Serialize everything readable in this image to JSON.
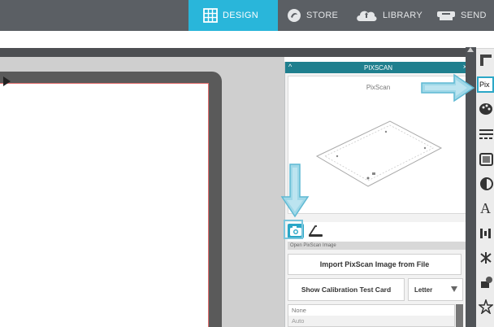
{
  "nav": {
    "tabs": [
      {
        "label": "DESIGN",
        "icon": "grid-icon",
        "active": true
      },
      {
        "label": "STORE",
        "icon": "silhouette-logo-icon",
        "active": false
      },
      {
        "label": "LIBRARY",
        "icon": "cloud-icon",
        "active": false
      },
      {
        "label": "SEND",
        "icon": "cutter-icon",
        "active": false
      }
    ],
    "active_color": "#29b6da"
  },
  "panel": {
    "title": "PIXSCAN",
    "preview_title": "PixScan",
    "section_label": "Open PixScan Image",
    "import_button": "Import PixScan Image from File",
    "calibration_button": "Show Calibration Test Card",
    "paper_size": "Letter",
    "list_items": [
      "None",
      "Auto"
    ]
  },
  "toolbar": {
    "pixscan_label": "Pix",
    "text_label": "A",
    "icons": [
      "page-setup-icon",
      "pixscan-icon",
      "fill-icon",
      "line-style-icon",
      "image-effects-icon",
      "offset-icon",
      "text-style-icon",
      "align-icon",
      "replicate-icon",
      "transform-icon",
      "library-icon"
    ]
  },
  "colors": {
    "accent": "#29b6da",
    "panel_header": "#1f7f8e",
    "mat_border": "#e36e6e",
    "annotation_arrow": "#7ac6dc"
  }
}
